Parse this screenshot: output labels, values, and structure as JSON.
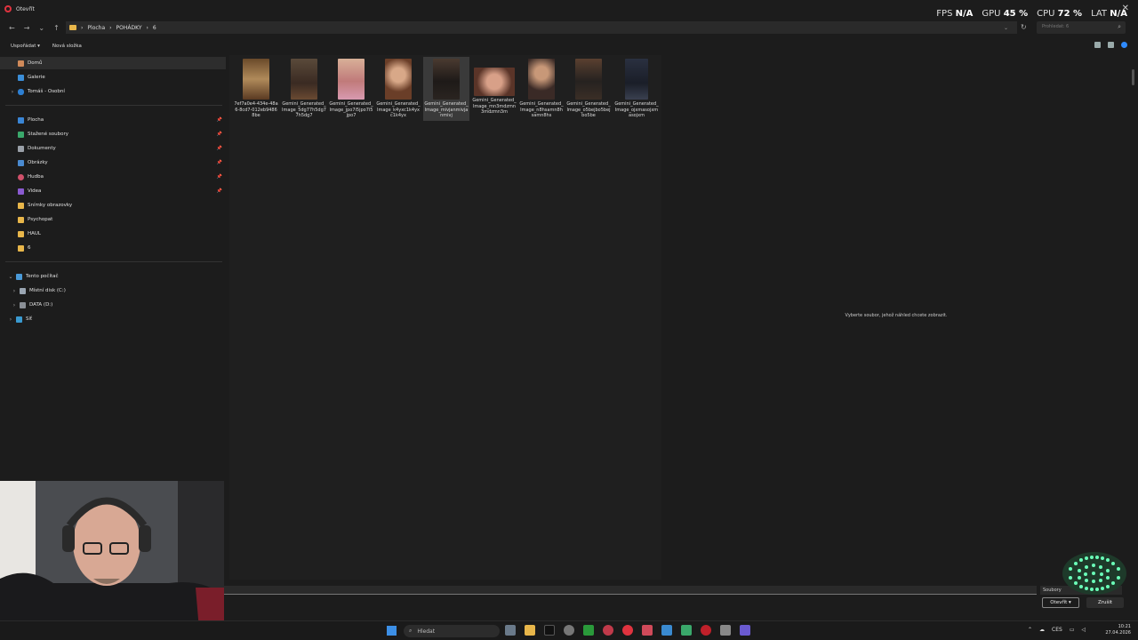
{
  "window": {
    "title": "Otevřít"
  },
  "overlay": {
    "fps_label": "FPS",
    "fps": "N/A",
    "gpu_label": "GPU",
    "gpu": "45 %",
    "cpu_label": "CPU",
    "cpu": "72 %",
    "lat_label": "LAT",
    "lat": "N/A"
  },
  "address": {
    "crumbs": [
      "Plocha",
      "POHÁDKY",
      "6"
    ],
    "search_placeholder": "Prohledat: 6"
  },
  "toolbar": {
    "organize": "Uspořádat",
    "new_folder": "Nová složka"
  },
  "sidebar": {
    "home": "Domů",
    "gallery": "Galerie",
    "personal": "Tomáš - Osobní",
    "quick": [
      "Plocha",
      "Stažené soubory",
      "Dokumenty",
      "Obrázky",
      "Hudba",
      "Videa"
    ],
    "folders": [
      "Snímky obrazovky",
      "Psychopat",
      "HAUL",
      "6"
    ],
    "this_pc": "Tento počítač",
    "drives": [
      "Místní disk (C:)",
      "DATA (D:)"
    ],
    "network": "Síť"
  },
  "files": [
    {
      "name": "7ef7a0e4-434e-48a6-8cd7-012eb94868be",
      "color": "#8a6a3e"
    },
    {
      "name": "Gemini_Generated_Image_5dg77h5dg77h5dg7",
      "color": "#4a3a30"
    },
    {
      "name": "Gemini_Generated_Image_jpo7i5jpo7i5jpo7",
      "color": "#c89a86"
    },
    {
      "name": "Gemini_Generated_Image_k4yxc1k4yxc1k4yx",
      "color": "#7a4e38"
    },
    {
      "name": "Gemini_Generated_Image_mivjanmivjanmivj",
      "color": "#2e2a28"
    },
    {
      "name": "Gemini_Generated_Image_mn3mdzmn3mdzmn3m",
      "color": "#6a4636"
    },
    {
      "name": "Gemini_Generated_Image_n8hsamn8hsamn8hs",
      "color": "#5a4a42"
    },
    {
      "name": "Gemini_Generated_Image_o5bejbo5bejbo5be",
      "color": "#4a3a2e"
    },
    {
      "name": "Gemini_Generated_Image_ojxmasojxmasojxm",
      "color": "#2a3040"
    }
  ],
  "preview": {
    "message": "Vyberte soubor, jehož náhled chcete zobrazit."
  },
  "bottom": {
    "file_type": "Soubory",
    "open": "Otevřít",
    "cancel": "Zrušit"
  },
  "taskbar": {
    "search": "Hledat",
    "lang": "CES",
    "time": "10:21",
    "date": "27.04.2026"
  }
}
